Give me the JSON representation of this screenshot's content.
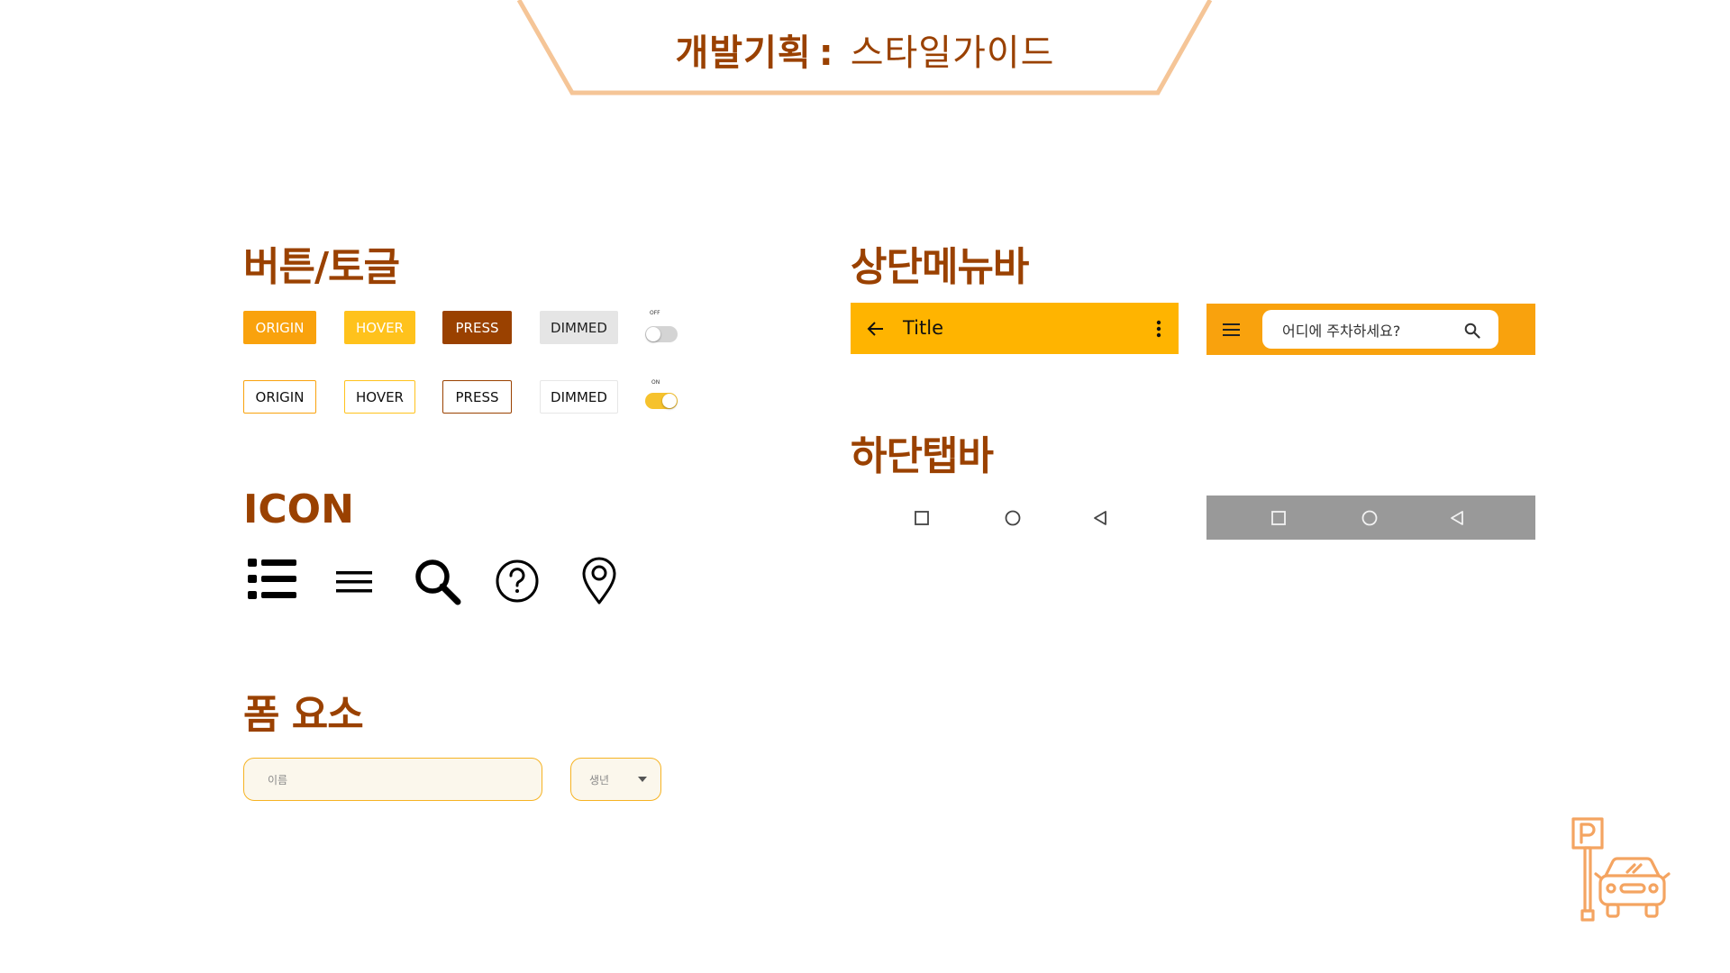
{
  "header": {
    "title_bold": "개발기획",
    "colon": ":",
    "title_light": "스타일가이드"
  },
  "colors": {
    "brand_dark": "#9a4100",
    "accent_orange": "#f9a20d",
    "accent_yellow": "#ffb400",
    "hover_yellow": "#ffc21c",
    "dimmed_gray": "#e5e5e5",
    "banner_stroke": "#f5c597",
    "nav_gray": "#999999"
  },
  "sections": {
    "buttons_toggle": "버튼/토글",
    "icon": "ICON",
    "form": "폼 요소",
    "top_menu": "상단메뉴바",
    "bottom_tab": "하단탭바"
  },
  "buttons": {
    "filled": [
      "ORIGIN",
      "HOVER",
      "PRESS",
      "DIMMED"
    ],
    "outline": [
      "ORIGIN",
      "HOVER",
      "PRESS",
      "DIMMED"
    ]
  },
  "toggles": {
    "off_label": "OFF",
    "on_label": "ON"
  },
  "icons": [
    "list-bullets-icon",
    "hamburger-menu-icon",
    "search-icon",
    "help-circle-icon",
    "location-pin-icon"
  ],
  "form": {
    "name_placeholder": "이름",
    "birth_year_placeholder": "생년"
  },
  "top_bar_1": {
    "title": "Title",
    "leading_icon": "arrow-back-icon",
    "trailing_icon": "more-vert-icon"
  },
  "top_bar_2": {
    "menu_icon": "hamburger-menu-icon",
    "search_placeholder": "어디에 주차하세요?",
    "search_icon": "search-icon"
  },
  "bottom_nav": {
    "buttons": [
      "square-icon",
      "circle-icon",
      "back-triangle-icon"
    ]
  },
  "logo": {
    "letter": "P",
    "icon": "parking-car-icon"
  }
}
